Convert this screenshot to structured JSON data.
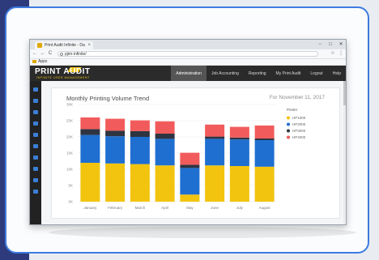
{
  "browser": {
    "tab_title": "Print Audit Infinite - Da",
    "tab_close": "×",
    "url": "pjim-infinite/",
    "bookmark": "Apps",
    "controls": {
      "minimize": "−",
      "maximize": "□",
      "close": "✕",
      "back": "←",
      "forward": "→",
      "reload": "C",
      "star": "☆",
      "menu": "⋮"
    }
  },
  "app": {
    "logo_text": "PRINT AUDIT",
    "logo_tagline": "INFINITE USER MANAGEMENT",
    "nav": [
      {
        "label": "Administration",
        "active": true
      },
      {
        "label": "Job Accounting",
        "active": false
      },
      {
        "label": "Reporting",
        "active": false
      },
      {
        "label": "My Print Audit",
        "active": false
      },
      {
        "label": "Logout",
        "active": false
      },
      {
        "label": "Help",
        "active": false
      }
    ],
    "sidebar_icons": [
      "settings-icon",
      "printer-icon",
      "users-icon",
      "card-icon",
      "lock-icon",
      "rocket-icon",
      "document-icon",
      "monitor-icon",
      "user-icon",
      "list-icon"
    ]
  },
  "panel": {
    "title": "Monthly Printing Volume Trend",
    "date": "For November 11, 2017"
  },
  "chart_data": {
    "type": "bar",
    "stacked": true,
    "categories": [
      "January",
      "February",
      "March",
      "April",
      "May",
      "June",
      "July",
      "August"
    ],
    "ylim": [
      0,
      30000
    ],
    "yticks": [
      0,
      5000,
      10000,
      15000,
      20000,
      25000,
      30000
    ],
    "ytick_labels": [
      "0K",
      "5K",
      "10K",
      "15K",
      "20K",
      "25K",
      "30K"
    ],
    "grid": true,
    "legend_title": "Printer",
    "legend_position": "right",
    "series": [
      {
        "name": "HP1000",
        "color": "#f2c40f",
        "values": [
          12000,
          11800,
          11600,
          11200,
          2200,
          11200,
          11000,
          10800
        ]
      },
      {
        "name": "HP2000",
        "color": "#1f6fd1",
        "values": [
          8600,
          8400,
          8400,
          8200,
          8200,
          8200,
          8200,
          8200
        ]
      },
      {
        "name": "HP3000",
        "color": "#2e3440",
        "values": [
          1800,
          1700,
          1800,
          1600,
          1000,
          700,
          600,
          500
        ]
      },
      {
        "name": "HP4000",
        "color": "#f25b5b",
        "values": [
          3600,
          3700,
          3300,
          3800,
          3700,
          3700,
          3300,
          4000
        ]
      }
    ]
  }
}
